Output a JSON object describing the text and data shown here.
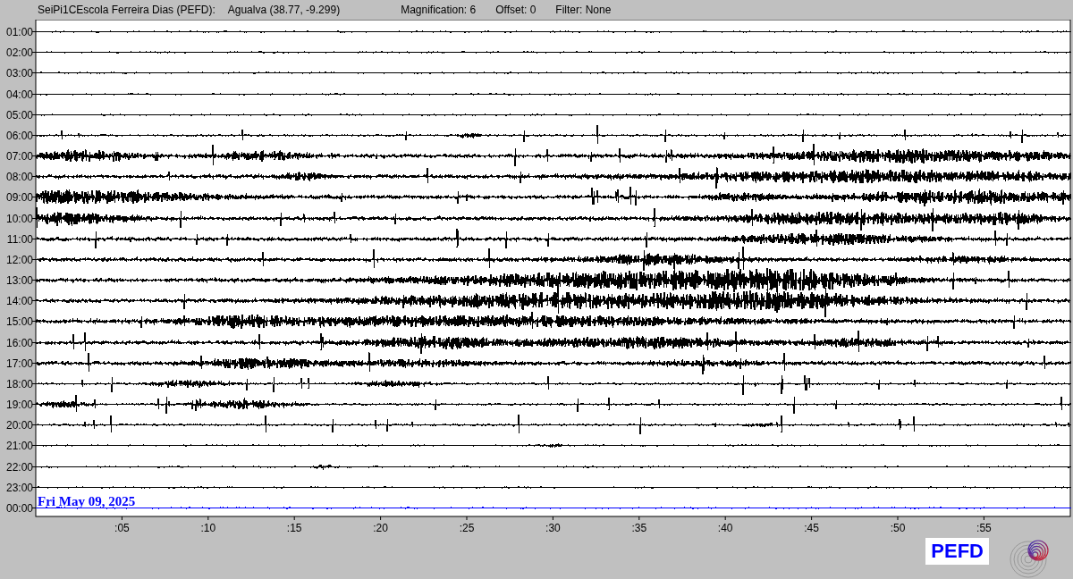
{
  "header": {
    "station": "SeiPi1CEscola Ferreira Dias (PEFD):",
    "location": "Agualva (38.77, -9.299)",
    "magnification": "Magnification: 6",
    "offset": "Offset: 0",
    "filter": "Filter: None"
  },
  "rows": [
    {
      "label": "01:00",
      "color": "#000000"
    },
    {
      "label": "02:00",
      "color": "#000000"
    },
    {
      "label": "03:00",
      "color": "#000000"
    },
    {
      "label": "04:00",
      "color": "#000000"
    },
    {
      "label": "05:00",
      "color": "#000000"
    },
    {
      "label": "06:00",
      "color": "#000000"
    },
    {
      "label": "07:00",
      "color": "#000000"
    },
    {
      "label": "08:00",
      "color": "#000000"
    },
    {
      "label": "09:00",
      "color": "#000000"
    },
    {
      "label": "10:00",
      "color": "#000000"
    },
    {
      "label": "11:00",
      "color": "#000000"
    },
    {
      "label": "12:00",
      "color": "#000000"
    },
    {
      "label": "13:00",
      "color": "#000000"
    },
    {
      "label": "14:00",
      "color": "#000000"
    },
    {
      "label": "15:00",
      "color": "#000000"
    },
    {
      "label": "16:00",
      "color": "#000000"
    },
    {
      "label": "17:00",
      "color": "#000000"
    },
    {
      "label": "18:00",
      "color": "#000000"
    },
    {
      "label": "19:00",
      "color": "#000000"
    },
    {
      "label": "20:00",
      "color": "#000000"
    },
    {
      "label": "21:00",
      "color": "#000000"
    },
    {
      "label": "22:00",
      "color": "#000000"
    },
    {
      "label": "23:00",
      "color": "#000000"
    },
    {
      "label": "00:00",
      "color": "#0000ff"
    }
  ],
  "date_label": "Fri May 09, 2025",
  "x_ticks": [
    ":05",
    ":10",
    ":15",
    ":20",
    ":25",
    ":30",
    ":35",
    ":40",
    ":45",
    ":50",
    ":55"
  ],
  "station_badge": "PEFD"
}
